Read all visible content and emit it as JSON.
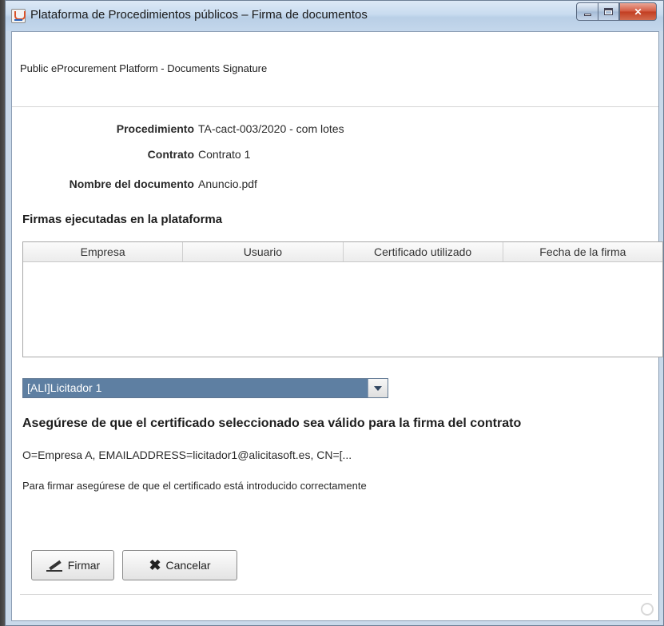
{
  "window": {
    "title": "Plataforma de Procedimientos públicos – Firma de documentos",
    "controls": [
      "minimize",
      "maximize",
      "close"
    ]
  },
  "header": {
    "subtitle": "Public eProcurement Platform - Documents Signature"
  },
  "details": {
    "procedimiento_label": "Procedimiento",
    "procedimiento_value": "TA-cact-003/2020 - com lotes",
    "contrato_label": "Contrato",
    "contrato_value": "Contrato 1",
    "documento_label": "Nombre del documento",
    "documento_value": "Anuncio.pdf"
  },
  "signatures": {
    "title": "Firmas ejecutadas en la plataforma",
    "columns": [
      "Empresa",
      "Usuario",
      "Certificado utilizado",
      "Fecha de la firma"
    ],
    "rows": []
  },
  "certificate_select": {
    "selected": "[ALI]Licitador 1"
  },
  "warning": "Asegúrese de que el certificado seleccionado sea válido para la firma del contrato",
  "certificate_subject": "O=Empresa A, EMAILADDRESS=licitador1@alicitasoft.es, CN=[...",
  "note": "Para firmar asegúrese de que el certificado está introducido correctamente",
  "buttons": {
    "sign_label": "Firmar",
    "cancel_label": "Cancelar"
  },
  "icons": {
    "app": "java-app-icon",
    "sign": "pencil-icon",
    "cancel": "x-icon",
    "dropdown": "chevron-down-icon"
  }
}
